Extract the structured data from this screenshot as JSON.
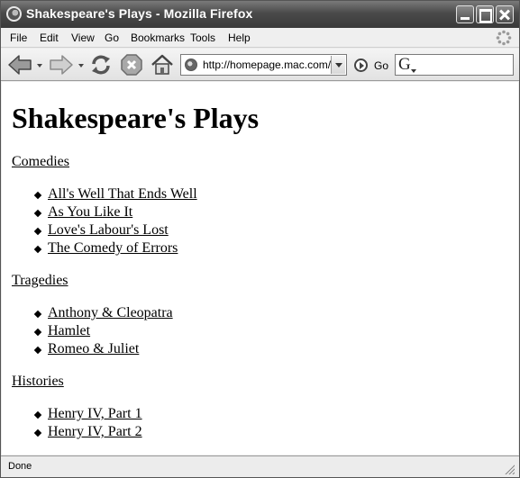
{
  "window": {
    "title": "Shakespeare's Plays - Mozilla Firefox"
  },
  "menu": {
    "items": [
      "File",
      "Edit",
      "View",
      "Go",
      "Bookmarks",
      "Tools",
      "Help"
    ]
  },
  "toolbar": {
    "url": "http://homepage.mac.com/d",
    "go_label": "Go",
    "search_value": "",
    "search_engine_glyph": "G"
  },
  "page": {
    "title": "Shakespeare's Plays",
    "sections": [
      {
        "label": "Comedies",
        "plays": [
          "All's Well That Ends Well",
          "As You Like It",
          "Love's Labour's Lost",
          "The Comedy of Errors"
        ]
      },
      {
        "label": "Tragedies",
        "plays": [
          "Anthony & Cleopatra",
          "Hamlet",
          "Romeo & Juliet"
        ]
      },
      {
        "label": "Histories",
        "plays": [
          "Henry IV, Part 1",
          "Henry IV, Part 2"
        ]
      }
    ]
  },
  "status": {
    "text": "Done"
  }
}
